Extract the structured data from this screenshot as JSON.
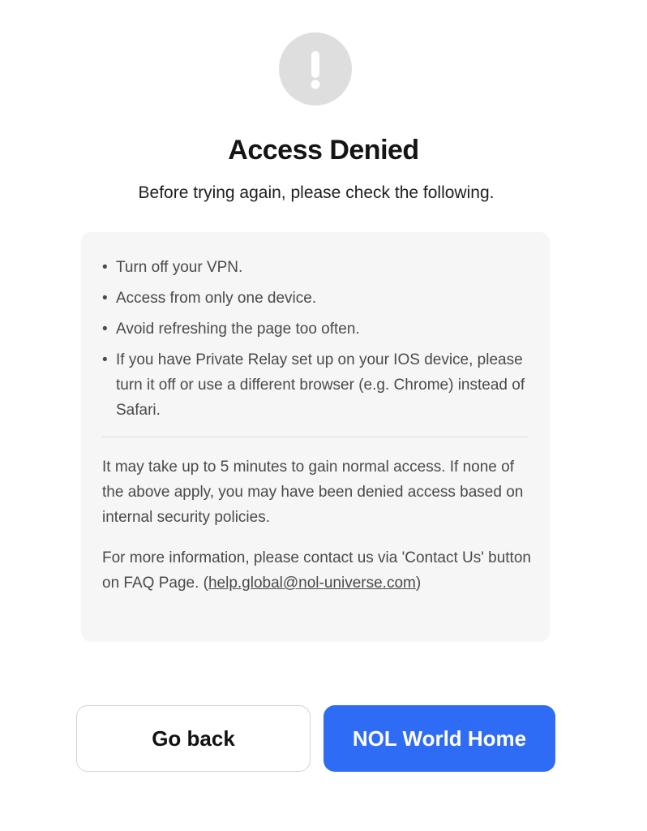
{
  "header": {
    "icon": "exclamation-icon",
    "icon_color": "#ffffff",
    "icon_bg": "#dedede",
    "title": "Access Denied",
    "subtitle": "Before trying again, please check the following."
  },
  "checklist": {
    "bullet": "•",
    "items": [
      "Turn off your VPN.",
      "Access from only one device.",
      "Avoid refreshing the page too often.",
      "If you have Private Relay set up on your IOS device, please turn it off or use a different browser (e.g. Chrome) instead of Safari."
    ]
  },
  "notes": {
    "wait_text": "It may take up to 5 minutes to gain normal access. If none of the above apply, you may have been denied access based on internal security policies.",
    "contact_prefix": "For more information, please contact us via 'Contact Us' button on FAQ Page. (",
    "contact_email": "help.global@nol-universe.com",
    "contact_suffix": ")"
  },
  "buttons": {
    "back_label": "Go back",
    "home_label": "NOL World Home",
    "home_color": "#2e6cf6"
  }
}
